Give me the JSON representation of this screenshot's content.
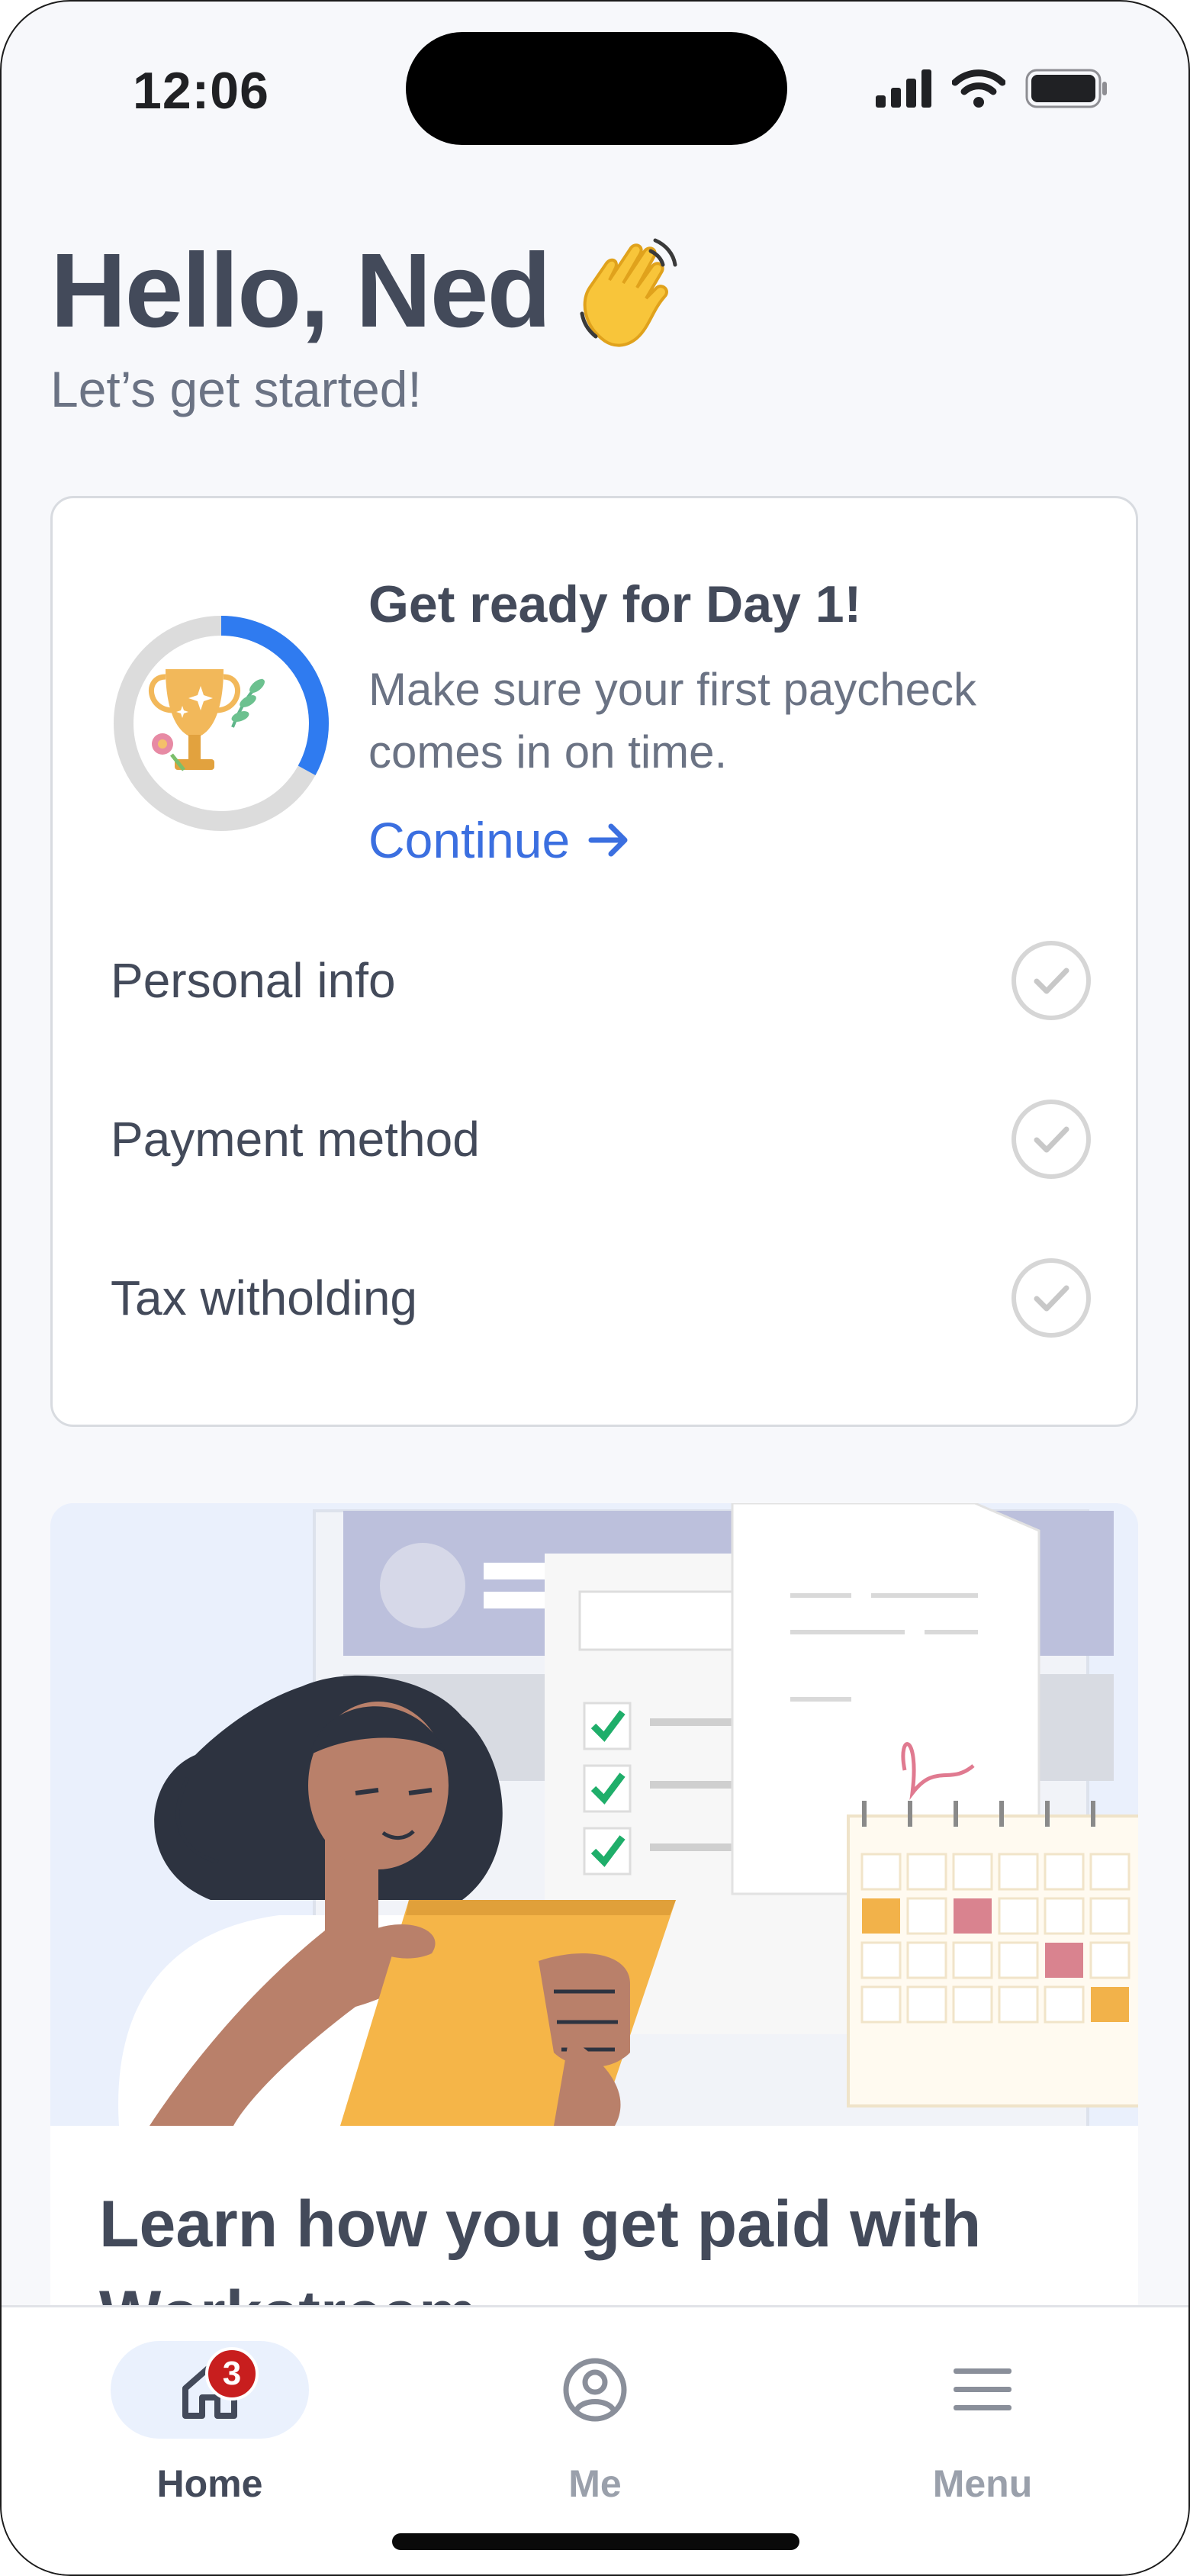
{
  "status_bar": {
    "time": "12:06"
  },
  "greeting": {
    "title": "Hello, Ned",
    "subtitle": "Let’s get started!",
    "emoji_icon": "waving-hand-icon"
  },
  "onboarding_card": {
    "title": "Get ready for Day 1!",
    "description": "Make sure your first paycheck comes in on time.",
    "continue_label": "Continue",
    "progress_fraction": 0.33,
    "tasks": [
      {
        "label": "Personal info",
        "completed": false
      },
      {
        "label": "Payment method",
        "completed": false
      },
      {
        "label": "Tax witholding",
        "completed": false
      }
    ]
  },
  "promo_card": {
    "title": "Learn how you get paid with Workstream"
  },
  "tab_bar": {
    "tabs": [
      {
        "label": "Home",
        "icon": "home-icon",
        "active": true,
        "badge": "3"
      },
      {
        "label": "Me",
        "icon": "user-circle-icon",
        "active": false
      },
      {
        "label": "Menu",
        "icon": "menu-icon",
        "active": false
      }
    ]
  },
  "colors": {
    "accent": "#3b6fe0",
    "text": "#434a5a",
    "muted": "#6b7384",
    "badge": "#c81e1e"
  }
}
